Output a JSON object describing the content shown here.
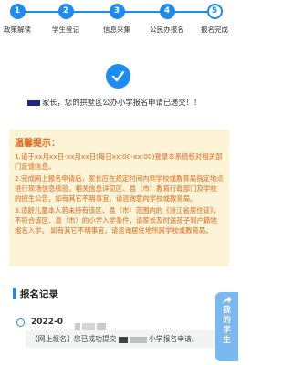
{
  "steps": [
    {
      "num": "1",
      "label": "政策解读"
    },
    {
      "num": "2",
      "label": "学生登记"
    },
    {
      "num": "3",
      "label": "信息采集"
    },
    {
      "num": "4",
      "label": "公民办报名"
    },
    {
      "num": "5",
      "label": "报名完成"
    }
  ],
  "success": {
    "message": "家长，您的拱墅区公办小学报名申请已递交！！"
  },
  "notice": {
    "title": "温馨提示：",
    "items": [
      "1.请于xx月xx日-xx月xx日(每日xx:00-xx:00)登录本系统核对相关部门反馈信息。",
      "2.完成网上报名申请后，家长应在规定时间内到学校或教育局指定地点进行现场信息核验，相关信息详见区、县（市）教育行政部门及学校的招生公告。如有其它不明事宜，请咨询意向学校或教育局。",
      "3.适龄儿童本人若未持有该区、县（市）范围内的《浙江省居住证》，不符合该区、县（市）的小学入学条件，请家长及时送孩子到户籍地报名入学。 如有其它不明事宜，请咨询居住地所属学校或教育局。"
    ]
  },
  "records": {
    "title": "报名记录",
    "item": {
      "date": "2022-0",
      "text": "【网上报名】您已成功提交",
      "text_tail": "小学报名申请。"
    }
  },
  "side_tab": {
    "label": "我的学生",
    "icon": "share-arrow-icon"
  },
  "colors": {
    "primary": "#1e8bf0",
    "notice_bg": "#fdf3d7",
    "notice_text": "#e0691b",
    "side_tab_bg": "#7ab8f0"
  }
}
